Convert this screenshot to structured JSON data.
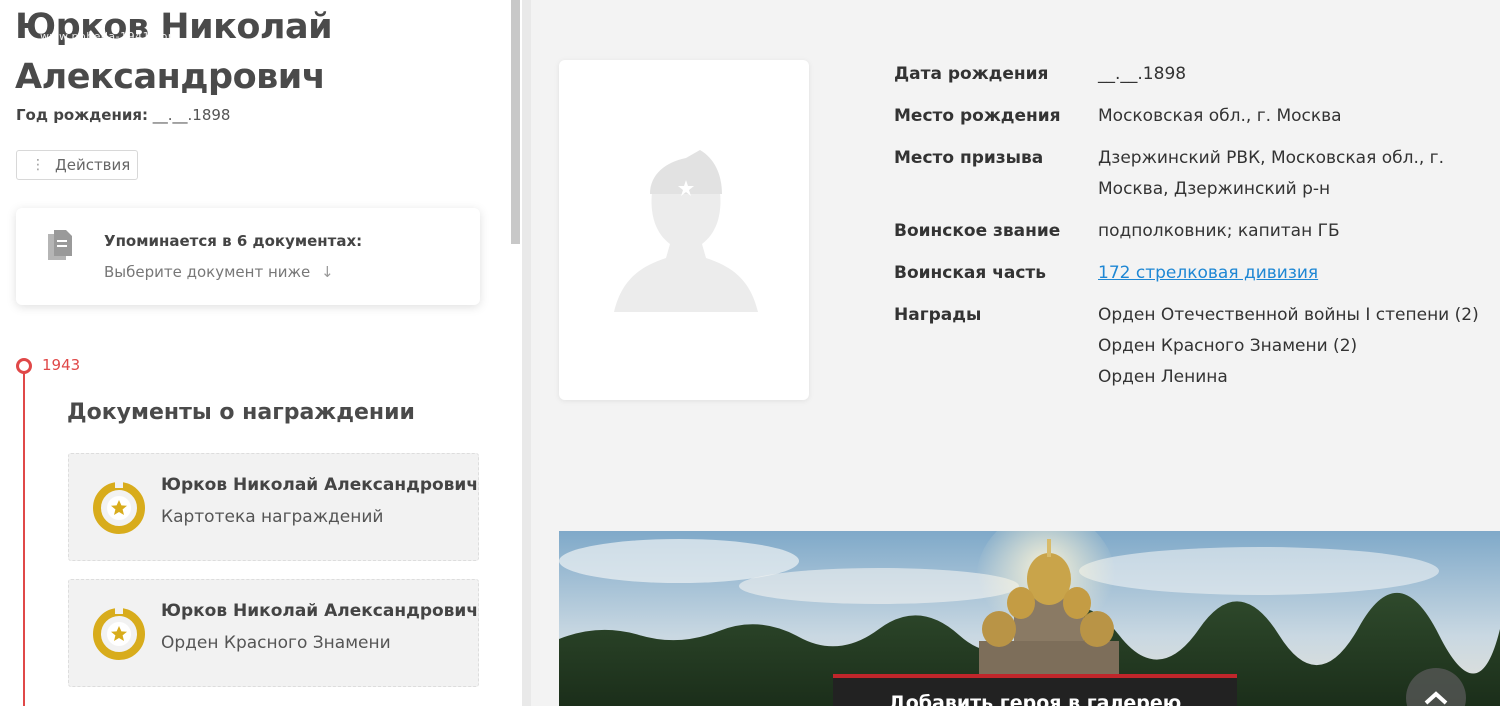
{
  "hero": {
    "name_line1": "Юрков Николай",
    "name_line2": "Александрович",
    "watermark": "www.pobeda-1941.com",
    "birth_label": "Год рождения:",
    "birth_value": "__.__.1898"
  },
  "actions": {
    "label": "Действия"
  },
  "documents": {
    "title": "Упоминается в 6 документах:",
    "subtitle": "Выберите документ ниже",
    "arrow": "↓"
  },
  "timeline": {
    "year": "1943",
    "section_title": "Документы о награждении",
    "items": [
      {
        "name": "Юрков Николай Александрович",
        "type": "Картотека награждений"
      },
      {
        "name": "Юрков Николай Александрович",
        "type": "Орден Красного Знамени"
      }
    ]
  },
  "info": {
    "birth_date_label": "Дата рождения",
    "birth_date_value": "__.__.1898",
    "birth_place_label": "Место рождения",
    "birth_place_value": "Московская обл., г. Москва",
    "draft_place_label": "Место призыва",
    "draft_place_line1": "Дзержинский РВК, Московская обл., г.",
    "draft_place_line2": "Москва, Дзержинский р-н",
    "rank_label": "Воинское звание",
    "rank_value": "подполковник; капитан ГБ",
    "unit_label": "Воинская часть",
    "unit_value": "172 стрелковая дивизия",
    "awards_label": "Награды",
    "awards": [
      "Орден Отечественной войны I степени (2)",
      "Орден Красного Знамени (2)",
      "Орден Ленина"
    ]
  },
  "banner": {
    "button_label": "Добавить героя в галерею"
  },
  "colors": {
    "accent_red": "#e04848",
    "link_blue": "#1e87d4",
    "medal_gold": "#d8ac1c"
  }
}
